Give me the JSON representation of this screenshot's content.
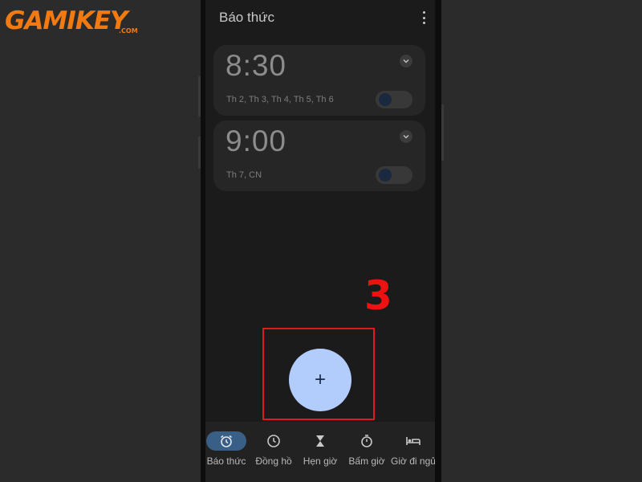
{
  "logo": {
    "text": "GAMIKEY",
    "domain": ".COM",
    "color": "#f27a12"
  },
  "app": {
    "title": "Báo thức"
  },
  "alarms": [
    {
      "time": "8:30",
      "days": "Th 2, Th 3, Th 4, Th 5, Th 6",
      "enabled": false
    },
    {
      "time": "9:00",
      "days": "Th 7, CN",
      "enabled": false
    }
  ],
  "fab": {
    "label": "+",
    "color": "#b2ccfb"
  },
  "nav": {
    "items": [
      {
        "label": "Báo thức",
        "icon": "alarm-icon",
        "active": true
      },
      {
        "label": "Đồng hồ",
        "icon": "clock-icon",
        "active": false
      },
      {
        "label": "Hẹn giờ",
        "icon": "hourglass-icon",
        "active": false
      },
      {
        "label": "Bấm giờ",
        "icon": "stopwatch-icon",
        "active": false
      },
      {
        "label": "Giờ đi ngủ",
        "icon": "bed-icon",
        "active": false
      }
    ]
  },
  "annotation": {
    "step": "3",
    "color": "#ee1111"
  }
}
